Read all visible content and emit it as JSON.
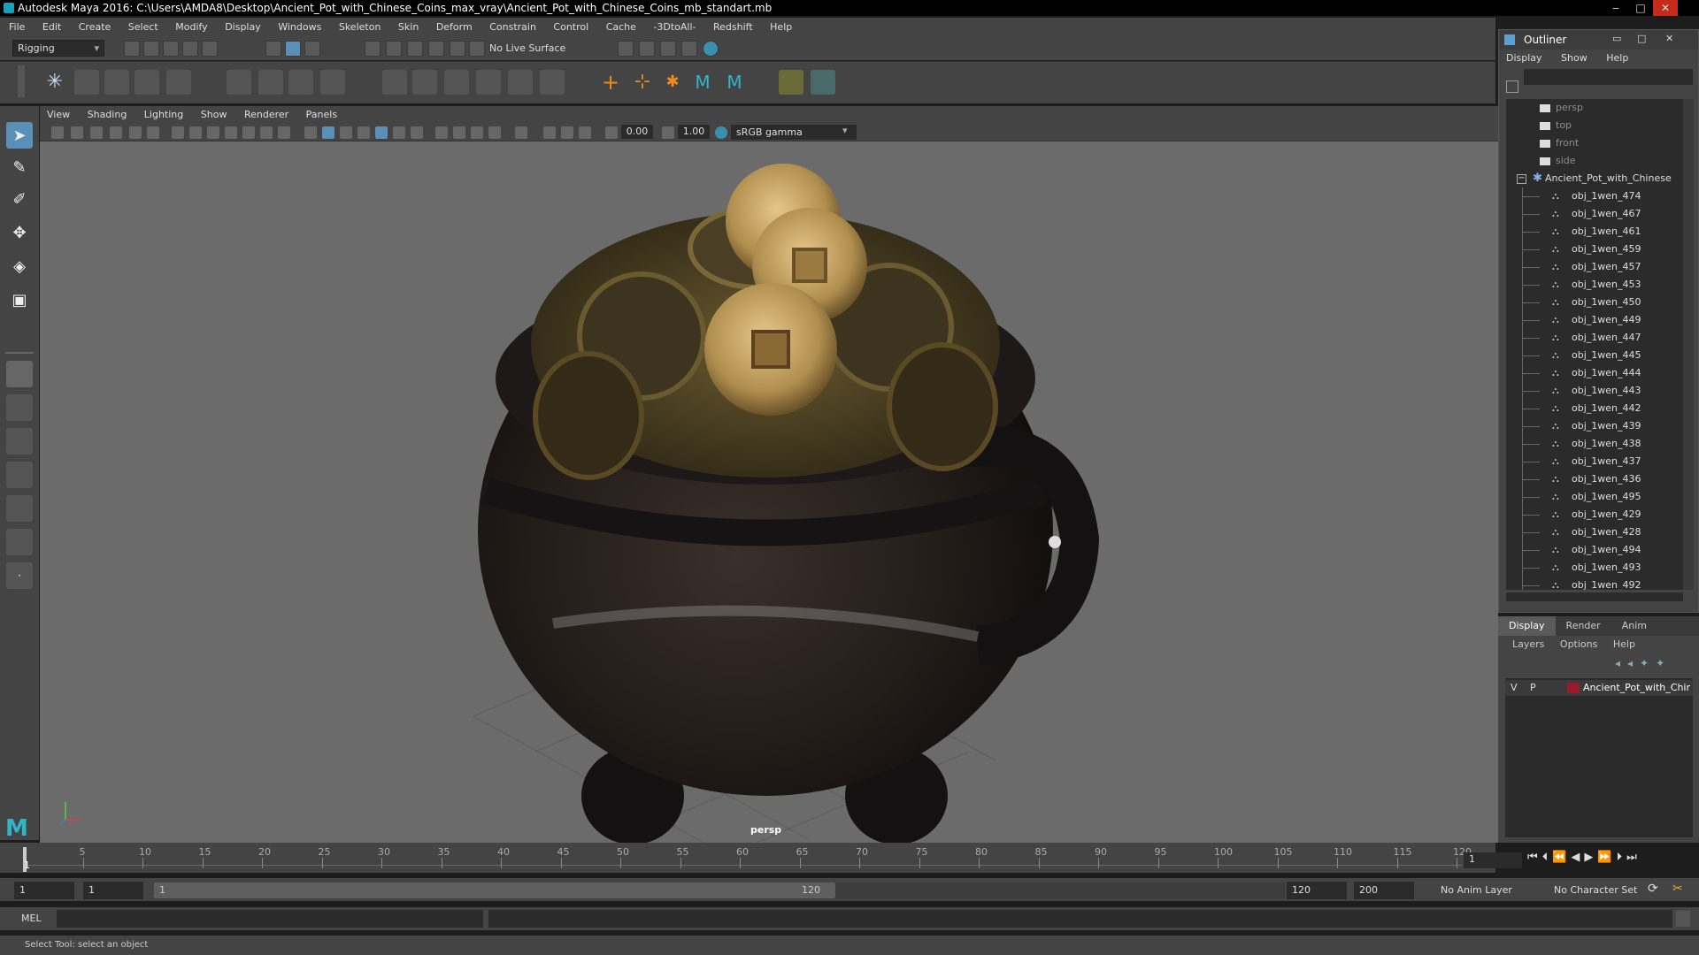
{
  "window": {
    "title": "Autodesk Maya 2016: C:\\Users\\AMDA8\\Desktop\\Ancient_Pot_with_Chinese_Coins_max_vray\\Ancient_Pot_with_Chinese_Coins_mb_standart.mb",
    "minimize": "‒",
    "maximize": "□",
    "close": "✕"
  },
  "menubar": [
    "File",
    "Edit",
    "Create",
    "Select",
    "Modify",
    "Display",
    "Windows",
    "Skeleton",
    "Skin",
    "Deform",
    "Constrain",
    "Control",
    "Cache",
    "-3DtoAll-",
    "Redshift",
    "Help"
  ],
  "toolbar": {
    "mode": "Rigging",
    "live_surface": "No Live Surface"
  },
  "viewport": {
    "menu": [
      "View",
      "Shading",
      "Lighting",
      "Show",
      "Renderer",
      "Panels"
    ],
    "field_a": "0.00",
    "field_b": "1.00",
    "color_space": "sRGB gamma",
    "camera_label": "persp"
  },
  "timeline": {
    "ticks": [
      "5",
      "10",
      "15",
      "20",
      "25",
      "30",
      "35",
      "40",
      "45",
      "50",
      "55",
      "60",
      "65",
      "70",
      "75",
      "80",
      "85",
      "90",
      "95",
      "100",
      "105",
      "110",
      "115",
      "120"
    ],
    "current_frame_tick": "1",
    "current_frame_field": "1"
  },
  "range": {
    "start": "1",
    "playback_start": "1",
    "slider_start": "1",
    "slider_end": "120",
    "playback_end": "120",
    "end": "200",
    "anim_layer": "No Anim Layer",
    "character_set": "No Character Set"
  },
  "command": {
    "lang": "MEL",
    "help": "Select Tool: select an object"
  },
  "outliner": {
    "title": "Outliner",
    "menu": [
      "Display",
      "Show",
      "Help"
    ],
    "cameras": [
      "persp",
      "top",
      "front",
      "side"
    ],
    "root": "Ancient_Pot_with_Chinese",
    "objects": [
      "obj_1wen_474",
      "obj_1wen_467",
      "obj_1wen_461",
      "obj_1wen_459",
      "obj_1wen_457",
      "obj_1wen_453",
      "obj_1wen_450",
      "obj_1wen_449",
      "obj_1wen_447",
      "obj_1wen_445",
      "obj_1wen_444",
      "obj_1wen_443",
      "obj_1wen_442",
      "obj_1wen_439",
      "obj_1wen_438",
      "obj_1wen_437",
      "obj_1wen_436",
      "obj_1wen_495",
      "obj_1wen_429",
      "obj_1wen_428",
      "obj_1wen_494",
      "obj_1wen_493",
      "obj_1wen_492"
    ]
  },
  "layers": {
    "tabs": [
      "Display",
      "Render",
      "Anim"
    ],
    "menu": [
      "Layers",
      "Options",
      "Help"
    ],
    "layer": {
      "v": "V",
      "p": "P",
      "name": "Ancient_Pot_with_Chir",
      "color": "#9a1b2c"
    }
  },
  "colors": {
    "ui_bg": "#444444",
    "viewport_bg": "#6b6b6b",
    "accent": "#1aa0b8"
  }
}
